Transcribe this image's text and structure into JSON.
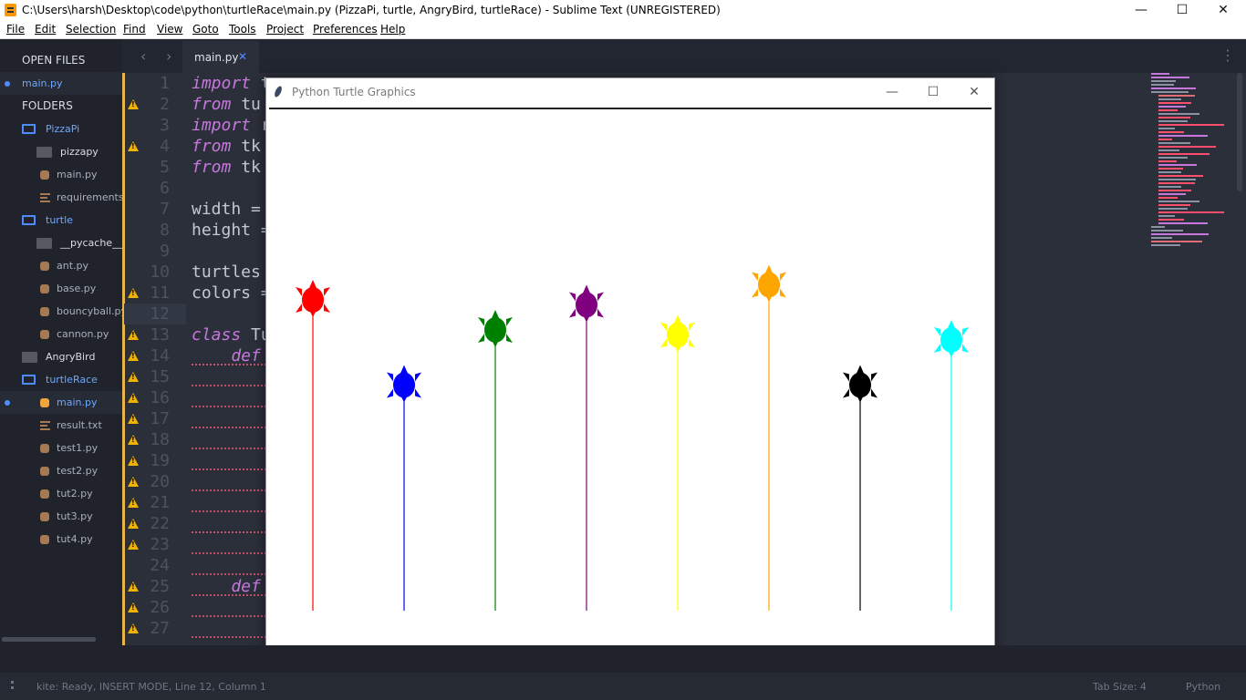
{
  "window": {
    "title": "C:\\Users\\harsh\\Desktop\\code\\python\\turtleRace\\main.py (PizzaPi, turtle, AngryBird, turtleRace) - Sublime Text (UNREGISTERED)",
    "minimize": "—",
    "maximize": "☐",
    "close": "✕"
  },
  "menu": [
    "File",
    "Edit",
    "Selection",
    "Find",
    "View",
    "Goto",
    "Tools",
    "Project",
    "Preferences",
    "Help"
  ],
  "sidebar": {
    "open_files_header": "OPEN FILES",
    "open_files": [
      "main.py"
    ],
    "folders_header": "FOLDERS",
    "tree": [
      {
        "label": "PizzaPi",
        "kind": "folder-open",
        "level": 1
      },
      {
        "label": "pizzapy",
        "kind": "folder",
        "level": 2
      },
      {
        "label": "main.py",
        "kind": "py",
        "level": 2
      },
      {
        "label": "requirements.txt",
        "kind": "txt",
        "level": 2
      },
      {
        "label": "turtle",
        "kind": "folder-open",
        "level": 1
      },
      {
        "label": "__pycache__",
        "kind": "folder",
        "level": 2
      },
      {
        "label": "ant.py",
        "kind": "py",
        "level": 2
      },
      {
        "label": "base.py",
        "kind": "py",
        "level": 2
      },
      {
        "label": "bouncyball.py",
        "kind": "py",
        "level": 2
      },
      {
        "label": "cannon.py",
        "kind": "py",
        "level": 2
      },
      {
        "label": "AngryBird",
        "kind": "folder",
        "level": 1
      },
      {
        "label": "turtleRace",
        "kind": "folder-open",
        "level": 1
      },
      {
        "label": "main.py",
        "kind": "py-active",
        "level": 2
      },
      {
        "label": "result.txt",
        "kind": "txt",
        "level": 2
      },
      {
        "label": "test1.py",
        "kind": "py",
        "level": 2
      },
      {
        "label": "test2.py",
        "kind": "py",
        "level": 2
      },
      {
        "label": "tut2.py",
        "kind": "py",
        "level": 2
      },
      {
        "label": "tut3.py",
        "kind": "py",
        "level": 2
      },
      {
        "label": "tut4.py",
        "kind": "py",
        "level": 2
      }
    ]
  },
  "tabs": {
    "nav_back": "‹",
    "nav_forward": "›",
    "active_tab": "main.py",
    "close": "✕",
    "menu": "⋮"
  },
  "editor": {
    "current_line": 12,
    "lines": [
      {
        "n": "1",
        "kw": "import",
        "rest": " t",
        "warn": false
      },
      {
        "n": "2",
        "kw": "from",
        "rest": " tu",
        "warn": true
      },
      {
        "n": "3",
        "kw": "import",
        "rest": " r",
        "warn": false
      },
      {
        "n": "4",
        "kw": "from",
        "rest": " tk",
        "warn": true
      },
      {
        "n": "5",
        "kw": "from",
        "rest": " tk",
        "warn": false
      },
      {
        "n": "6",
        "kw": "",
        "rest": "",
        "warn": false
      },
      {
        "n": "7",
        "kw": "",
        "rest": "width =",
        "warn": false
      },
      {
        "n": "8",
        "kw": "",
        "rest": "height =",
        "warn": false
      },
      {
        "n": "9",
        "kw": "",
        "rest": "",
        "warn": false
      },
      {
        "n": "10",
        "kw": "",
        "rest": "turtles",
        "warn": false
      },
      {
        "n": "11",
        "kw": "",
        "rest": "colors =",
        "warn": true
      },
      {
        "n": "12",
        "kw": "",
        "rest": "",
        "warn": false
      },
      {
        "n": "13",
        "kw": "class",
        "rest": " Tu",
        "warn": true
      },
      {
        "n": "14",
        "kw": "    def",
        "rest": "",
        "warn": true
      },
      {
        "n": "15",
        "kw": "",
        "rest": "",
        "warn": true
      },
      {
        "n": "16",
        "kw": "",
        "rest": "",
        "warn": true
      },
      {
        "n": "17",
        "kw": "",
        "rest": "",
        "warn": true
      },
      {
        "n": "18",
        "kw": "",
        "rest": "",
        "warn": true
      },
      {
        "n": "19",
        "kw": "",
        "rest": "",
        "warn": true
      },
      {
        "n": "20",
        "kw": "",
        "rest": "",
        "warn": true
      },
      {
        "n": "21",
        "kw": "",
        "rest": "",
        "warn": true
      },
      {
        "n": "22",
        "kw": "",
        "rest": "",
        "warn": true
      },
      {
        "n": "23",
        "kw": "",
        "rest": "",
        "warn": true
      },
      {
        "n": "24",
        "kw": "",
        "rest": "",
        "warn": false
      },
      {
        "n": "25",
        "kw": "    def",
        "rest": "",
        "warn": true
      },
      {
        "n": "26",
        "kw": "",
        "rest": "",
        "warn": true
      },
      {
        "n": "27",
        "kw": "",
        "rest": "",
        "warn": true
      }
    ]
  },
  "turtle_window": {
    "title": "Python Turtle Graphics",
    "minimize": "—",
    "maximize": "☐",
    "close": "✕",
    "turtles": [
      {
        "color": "#ff0000",
        "progress": 0.62
      },
      {
        "color": "#0000ff",
        "progress": 0.45
      },
      {
        "color": "#008000",
        "progress": 0.56
      },
      {
        "color": "#800080",
        "progress": 0.61
      },
      {
        "color": "#ffff00",
        "progress": 0.55
      },
      {
        "color": "#ffa500",
        "progress": 0.65
      },
      {
        "color": "#000000",
        "progress": 0.45
      },
      {
        "color": "#00ffff",
        "progress": 0.54
      }
    ]
  },
  "status": {
    "left": "kite: Ready, INSERT MODE, Line 12, Column 1",
    "tab_size": "Tab Size: 4",
    "syntax": "Python"
  },
  "colors": {
    "accent": "#4f8cff",
    "warning": "#f0b400",
    "keyword": "#c678dd",
    "editor_bg": "#2b2f3a"
  }
}
